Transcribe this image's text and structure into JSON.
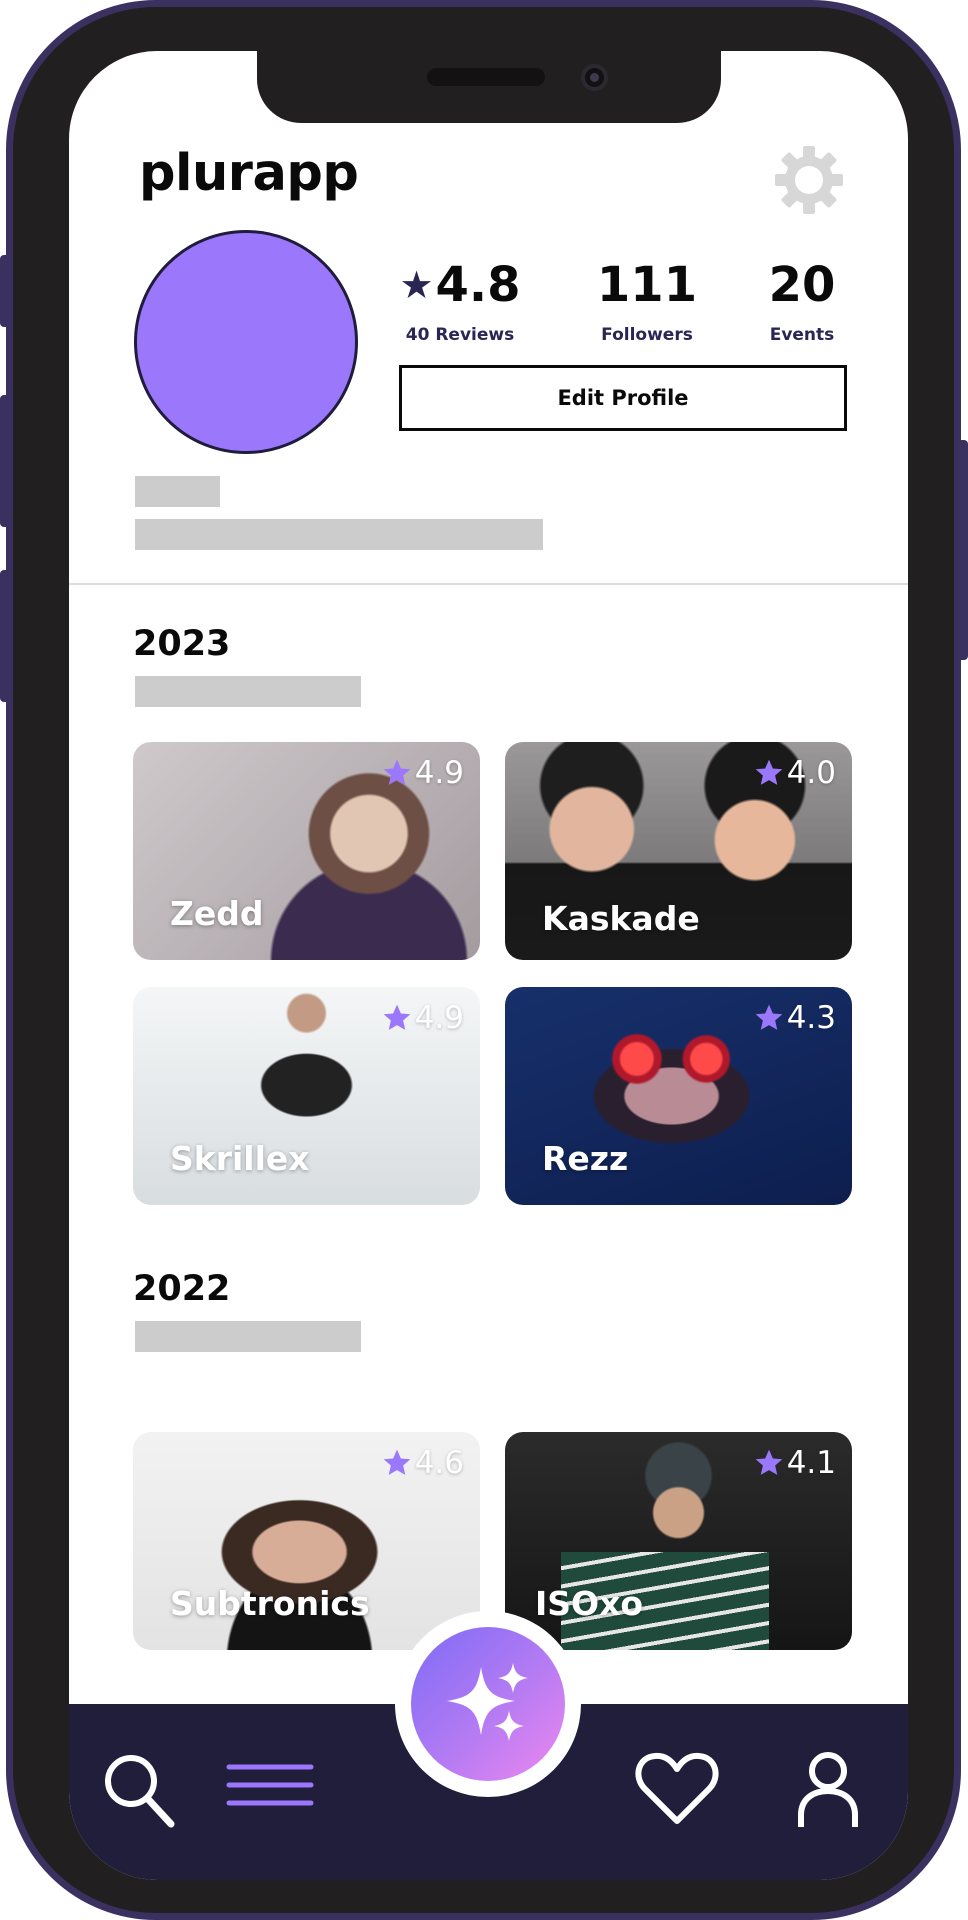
{
  "app": {
    "title": "plurapp"
  },
  "profile": {
    "rating": {
      "value": "4.8",
      "label": "40 Reviews"
    },
    "followers": {
      "value": "111",
      "label": "Followers"
    },
    "events": {
      "value": "20",
      "label": "Events"
    },
    "edit_label": "Edit Profile"
  },
  "sections": [
    {
      "year": "2023",
      "cards": [
        {
          "name": "Zedd",
          "rating": "4.9"
        },
        {
          "name": "Kaskade",
          "rating": "4.0"
        },
        {
          "name": "Skrillex",
          "rating": "4.9"
        },
        {
          "name": "Rezz",
          "rating": "4.3"
        }
      ]
    },
    {
      "year": "2022",
      "cards": [
        {
          "name": "Subtronics",
          "rating": "4.6"
        },
        {
          "name": "ISOxo",
          "rating": "4.1"
        }
      ]
    }
  ],
  "nav": {
    "items": [
      "search-icon",
      "menu-icon",
      "sparkle-icon",
      "heart-icon",
      "user-icon"
    ]
  },
  "colors": {
    "accent": "#9b77fc",
    "navy": "#211e3c",
    "frame": "#3b3160"
  }
}
